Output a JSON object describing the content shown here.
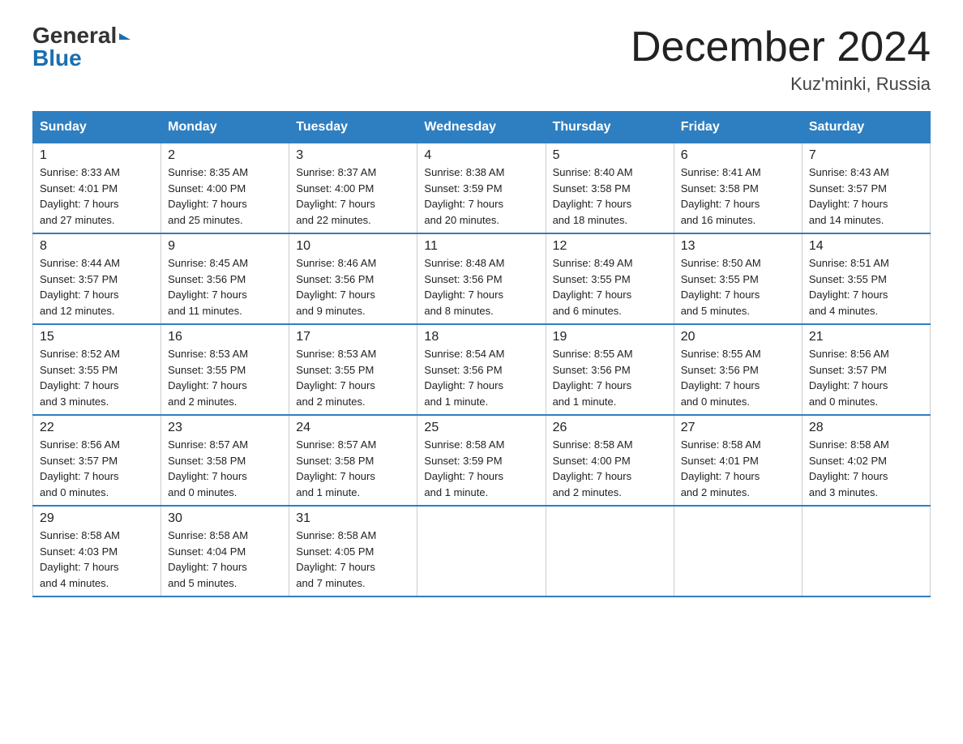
{
  "header": {
    "logo_general": "General",
    "logo_blue": "Blue",
    "title": "December 2024",
    "subtitle": "Kuz'minki, Russia"
  },
  "weekdays": [
    "Sunday",
    "Monday",
    "Tuesday",
    "Wednesday",
    "Thursday",
    "Friday",
    "Saturday"
  ],
  "weeks": [
    [
      {
        "day": "1",
        "info": "Sunrise: 8:33 AM\nSunset: 4:01 PM\nDaylight: 7 hours\nand 27 minutes."
      },
      {
        "day": "2",
        "info": "Sunrise: 8:35 AM\nSunset: 4:00 PM\nDaylight: 7 hours\nand 25 minutes."
      },
      {
        "day": "3",
        "info": "Sunrise: 8:37 AM\nSunset: 4:00 PM\nDaylight: 7 hours\nand 22 minutes."
      },
      {
        "day": "4",
        "info": "Sunrise: 8:38 AM\nSunset: 3:59 PM\nDaylight: 7 hours\nand 20 minutes."
      },
      {
        "day": "5",
        "info": "Sunrise: 8:40 AM\nSunset: 3:58 PM\nDaylight: 7 hours\nand 18 minutes."
      },
      {
        "day": "6",
        "info": "Sunrise: 8:41 AM\nSunset: 3:58 PM\nDaylight: 7 hours\nand 16 minutes."
      },
      {
        "day": "7",
        "info": "Sunrise: 8:43 AM\nSunset: 3:57 PM\nDaylight: 7 hours\nand 14 minutes."
      }
    ],
    [
      {
        "day": "8",
        "info": "Sunrise: 8:44 AM\nSunset: 3:57 PM\nDaylight: 7 hours\nand 12 minutes."
      },
      {
        "day": "9",
        "info": "Sunrise: 8:45 AM\nSunset: 3:56 PM\nDaylight: 7 hours\nand 11 minutes."
      },
      {
        "day": "10",
        "info": "Sunrise: 8:46 AM\nSunset: 3:56 PM\nDaylight: 7 hours\nand 9 minutes."
      },
      {
        "day": "11",
        "info": "Sunrise: 8:48 AM\nSunset: 3:56 PM\nDaylight: 7 hours\nand 8 minutes."
      },
      {
        "day": "12",
        "info": "Sunrise: 8:49 AM\nSunset: 3:55 PM\nDaylight: 7 hours\nand 6 minutes."
      },
      {
        "day": "13",
        "info": "Sunrise: 8:50 AM\nSunset: 3:55 PM\nDaylight: 7 hours\nand 5 minutes."
      },
      {
        "day": "14",
        "info": "Sunrise: 8:51 AM\nSunset: 3:55 PM\nDaylight: 7 hours\nand 4 minutes."
      }
    ],
    [
      {
        "day": "15",
        "info": "Sunrise: 8:52 AM\nSunset: 3:55 PM\nDaylight: 7 hours\nand 3 minutes."
      },
      {
        "day": "16",
        "info": "Sunrise: 8:53 AM\nSunset: 3:55 PM\nDaylight: 7 hours\nand 2 minutes."
      },
      {
        "day": "17",
        "info": "Sunrise: 8:53 AM\nSunset: 3:55 PM\nDaylight: 7 hours\nand 2 minutes."
      },
      {
        "day": "18",
        "info": "Sunrise: 8:54 AM\nSunset: 3:56 PM\nDaylight: 7 hours\nand 1 minute."
      },
      {
        "day": "19",
        "info": "Sunrise: 8:55 AM\nSunset: 3:56 PM\nDaylight: 7 hours\nand 1 minute."
      },
      {
        "day": "20",
        "info": "Sunrise: 8:55 AM\nSunset: 3:56 PM\nDaylight: 7 hours\nand 0 minutes."
      },
      {
        "day": "21",
        "info": "Sunrise: 8:56 AM\nSunset: 3:57 PM\nDaylight: 7 hours\nand 0 minutes."
      }
    ],
    [
      {
        "day": "22",
        "info": "Sunrise: 8:56 AM\nSunset: 3:57 PM\nDaylight: 7 hours\nand 0 minutes."
      },
      {
        "day": "23",
        "info": "Sunrise: 8:57 AM\nSunset: 3:58 PM\nDaylight: 7 hours\nand 0 minutes."
      },
      {
        "day": "24",
        "info": "Sunrise: 8:57 AM\nSunset: 3:58 PM\nDaylight: 7 hours\nand 1 minute."
      },
      {
        "day": "25",
        "info": "Sunrise: 8:58 AM\nSunset: 3:59 PM\nDaylight: 7 hours\nand 1 minute."
      },
      {
        "day": "26",
        "info": "Sunrise: 8:58 AM\nSunset: 4:00 PM\nDaylight: 7 hours\nand 2 minutes."
      },
      {
        "day": "27",
        "info": "Sunrise: 8:58 AM\nSunset: 4:01 PM\nDaylight: 7 hours\nand 2 minutes."
      },
      {
        "day": "28",
        "info": "Sunrise: 8:58 AM\nSunset: 4:02 PM\nDaylight: 7 hours\nand 3 minutes."
      }
    ],
    [
      {
        "day": "29",
        "info": "Sunrise: 8:58 AM\nSunset: 4:03 PM\nDaylight: 7 hours\nand 4 minutes."
      },
      {
        "day": "30",
        "info": "Sunrise: 8:58 AM\nSunset: 4:04 PM\nDaylight: 7 hours\nand 5 minutes."
      },
      {
        "day": "31",
        "info": "Sunrise: 8:58 AM\nSunset: 4:05 PM\nDaylight: 7 hours\nand 7 minutes."
      },
      {
        "day": "",
        "info": ""
      },
      {
        "day": "",
        "info": ""
      },
      {
        "day": "",
        "info": ""
      },
      {
        "day": "",
        "info": ""
      }
    ]
  ]
}
